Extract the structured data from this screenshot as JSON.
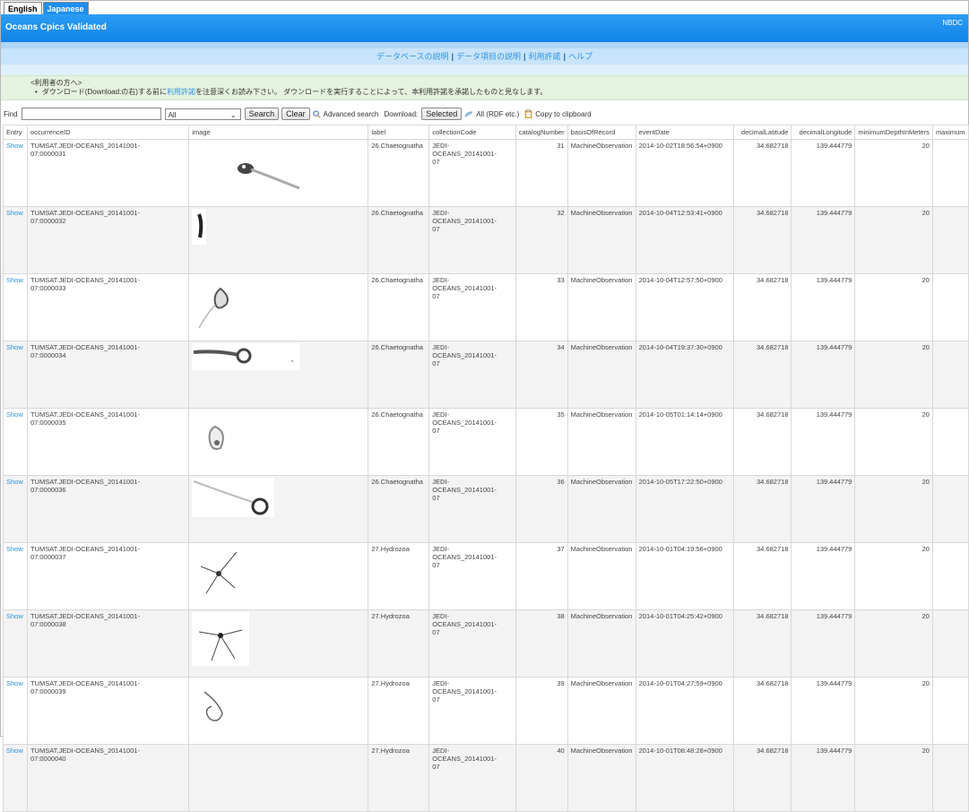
{
  "lang": {
    "english": "English",
    "japanese": "Japanese"
  },
  "banner": {
    "title": "Oceans Cpics Validated",
    "nbdc": "NBDC"
  },
  "nav": {
    "items": [
      "データベースの説明",
      "データ項目の説明",
      "利用許諾",
      "ヘルプ"
    ],
    "separator": "|"
  },
  "notice": {
    "line1": "<利用者の方へ>",
    "bullet": "•",
    "line2_a": "ダウンロード(Download:の右)する前に",
    "line2_link": "利用許諾",
    "line2_b": "を注意深くお読み下さい。 ダウンロードを実行することによって、本利用許諾を承諾したものと見なします。"
  },
  "toolbar": {
    "find_label": "Find",
    "find_value": "",
    "select_value": "All",
    "search_label": "Search",
    "clear_label": "Clear",
    "advanced_label": "Advanced search",
    "download_label": "Download:",
    "selected_label": "Selected",
    "all_label": "All (RDF etc.)",
    "copy_label": "Copy to clipboard"
  },
  "columns": [
    "Entry",
    "occurrenceID",
    "image",
    "label",
    "collectionCode",
    "catalogNumber",
    "basisOfRecord",
    "eventDate",
    "decimalLatitude",
    "decimalLongitude",
    "minimumDepthInMeters",
    "maximum"
  ],
  "rows": [
    {
      "entry": "Show",
      "occ1": "TUMSAT.JEDI-OCEANS_20141001-",
      "occ2": "07:0000031",
      "label": "26.Chaetognatha",
      "coll1": "JEDI-OCEANS_20141001-",
      "coll2": "07",
      "catalog": "31",
      "basis": "MachineObservation",
      "date": "2014-10-02T18:56:54+0900",
      "lat": "34.682718",
      "lon": "139.444779",
      "depth": "20",
      "max": ""
    },
    {
      "entry": "Show",
      "occ1": "TUMSAT.JEDI-OCEANS_20141001-",
      "occ2": "07:0000032",
      "label": "26.Chaetognatha",
      "coll1": "JEDI-OCEANS_20141001-",
      "coll2": "07",
      "catalog": "32",
      "basis": "MachineObservation",
      "date": "2014-10-04T12:53:41+0900",
      "lat": "34.682718",
      "lon": "139.444779",
      "depth": "20",
      "max": ""
    },
    {
      "entry": "Show",
      "occ1": "TUMSAT.JEDI-OCEANS_20141001-",
      "occ2": "07:0000033",
      "label": "26.Chaetognatha",
      "coll1": "JEDI-OCEANS_20141001-",
      "coll2": "07",
      "catalog": "33",
      "basis": "MachineObservation",
      "date": "2014-10-04T12:57:50+0900",
      "lat": "34.682718",
      "lon": "139.444779",
      "depth": "20",
      "max": ""
    },
    {
      "entry": "Show",
      "occ1": "TUMSAT.JEDI-OCEANS_20141001-",
      "occ2": "07:0000034",
      "label": "26.Chaetognatha",
      "coll1": "JEDI-OCEANS_20141001-",
      "coll2": "07",
      "catalog": "34",
      "basis": "MachineObservation",
      "date": "2014-10-04T19:37:30+0900",
      "lat": "34.682718",
      "lon": "139.444779",
      "depth": "20",
      "max": ""
    },
    {
      "entry": "Show",
      "occ1": "TUMSAT.JEDI-OCEANS_20141001-",
      "occ2": "07:0000035",
      "label": "26.Chaetognatha",
      "coll1": "JEDI-OCEANS_20141001-",
      "coll2": "07",
      "catalog": "35",
      "basis": "MachineObservation",
      "date": "2014-10-05T01:14:14+0900",
      "lat": "34.682718",
      "lon": "139.444779",
      "depth": "20",
      "max": ""
    },
    {
      "entry": "Show",
      "occ1": "TUMSAT.JEDI-OCEANS_20141001-",
      "occ2": "07:0000036",
      "label": "26.Chaetognatha",
      "coll1": "JEDI-OCEANS_20141001-",
      "coll2": "07",
      "catalog": "36",
      "basis": "MachineObservation",
      "date": "2014-10-05T17:22:50+0900",
      "lat": "34.682718",
      "lon": "139.444779",
      "depth": "20",
      "max": ""
    },
    {
      "entry": "Show",
      "occ1": "TUMSAT.JEDI-OCEANS_20141001-",
      "occ2": "07:0000037",
      "label": "27.Hydrozoa",
      "coll1": "JEDI-OCEANS_20141001-",
      "coll2": "07",
      "catalog": "37",
      "basis": "MachineObservation",
      "date": "2014-10-01T04:19:56+0900",
      "lat": "34.682718",
      "lon": "139.444779",
      "depth": "20",
      "max": ""
    },
    {
      "entry": "Show",
      "occ1": "TUMSAT.JEDI-OCEANS_20141001-",
      "occ2": "07:0000038",
      "label": "27.Hydrozoa",
      "coll1": "JEDI-OCEANS_20141001-",
      "coll2": "07",
      "catalog": "38",
      "basis": "MachineObservation",
      "date": "2014-10-01T04:25:42+0900",
      "lat": "34.682718",
      "lon": "139.444779",
      "depth": "20",
      "max": ""
    },
    {
      "entry": "Show",
      "occ1": "TUMSAT.JEDI-OCEANS_20141001-",
      "occ2": "07:0000039",
      "label": "27.Hydrozoa",
      "coll1": "JEDI-OCEANS_20141001-",
      "coll2": "07",
      "catalog": "39",
      "basis": "MachineObservation",
      "date": "2014-10-01T04:27:59+0900",
      "lat": "34.682718",
      "lon": "139.444779",
      "depth": "20",
      "max": ""
    },
    {
      "entry": "Show",
      "occ1": "TUMSAT.JEDI-OCEANS_20141001-",
      "occ2": "07:0000040",
      "label": "27.Hydrozoa",
      "coll1": "JEDI-OCEANS_20141001-",
      "coll2": "07",
      "catalog": "40",
      "basis": "MachineObservation",
      "date": "2014-10-01T08:48:28+0900",
      "lat": "34.682718",
      "lon": "139.444779",
      "depth": "20",
      "max": ""
    }
  ]
}
